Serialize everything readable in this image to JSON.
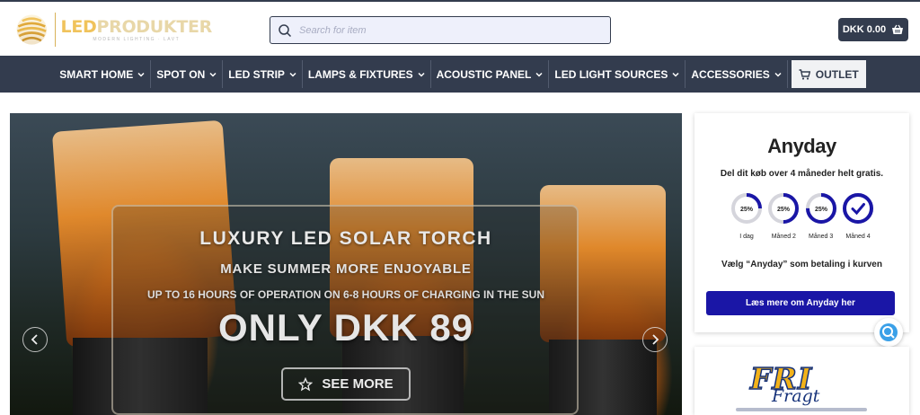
{
  "header": {
    "logo": {
      "text_accent": "LED",
      "text_main": "PRODUKTER",
      "tagline": "MODERN LIGHTING · LAVT"
    },
    "search": {
      "placeholder": "Search for item"
    },
    "cart": {
      "label": "DKK 0.00",
      "icon": "basket-icon"
    }
  },
  "nav": {
    "items": [
      {
        "label": "SMART HOME"
      },
      {
        "label": "SPOT ON"
      },
      {
        "label": "LED STRIP"
      },
      {
        "label": "LAMPS & FIXTURES"
      },
      {
        "label": "ACOUSTIC PANEL"
      },
      {
        "label": "LED LIGHT SOURCES"
      },
      {
        "label": "ACCESSORIES"
      }
    ],
    "outlet": {
      "label": "OUTLET",
      "icon": "cart-icon"
    }
  },
  "hero": {
    "headline": "LUXURY LED SOLAR TORCH",
    "subheadline": "MAKE SUMMER MORE ENJOYABLE",
    "detail": "UP TO 16 HOURS OF OPERATION ON 6-8 HOURS OF CHARGING IN THE SUN",
    "price": "ONLY DKK 89",
    "cta": "SEE MORE",
    "cta_icon": "star-icon"
  },
  "anyday": {
    "logo": "Anyday",
    "tagline": "Del dit køb over 4 måneder helt gratis.",
    "steps": [
      {
        "pct": "25%",
        "label": "I dag",
        "progress": 0.25
      },
      {
        "pct": "25%",
        "label": "Måned 2",
        "progress": 0.5
      },
      {
        "pct": "25%",
        "label": "Måned 3",
        "progress": 0.75
      },
      {
        "pct": "",
        "label": "Måned 4",
        "progress": 1.0
      }
    ],
    "choose": "Vælg “Anyday” som betaling i kurven",
    "button": "Læs mere om Anyday her"
  },
  "promo": {
    "logo": "FRI",
    "script": "Fragt"
  },
  "colors": {
    "nav_bg": "#333c4e",
    "anyday_blue": "#1a16a6",
    "logo_gold": "#f0c35c",
    "fri_yellow": "#f2b21a",
    "fri_navy": "#16327a"
  }
}
